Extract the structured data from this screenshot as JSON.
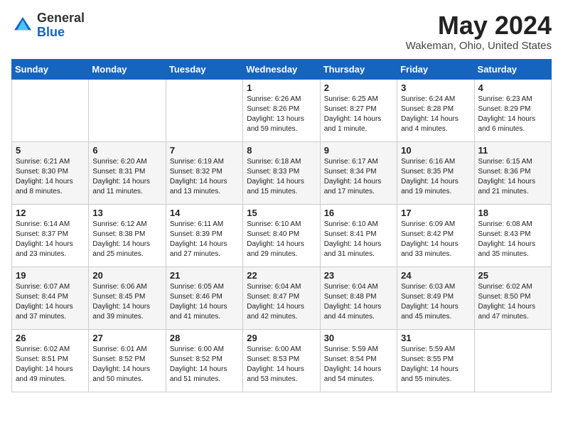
{
  "logo": {
    "general": "General",
    "blue": "Blue"
  },
  "title": {
    "month": "May 2024",
    "location": "Wakeman, Ohio, United States"
  },
  "weekdays": [
    "Sunday",
    "Monday",
    "Tuesday",
    "Wednesday",
    "Thursday",
    "Friday",
    "Saturday"
  ],
  "weeks": [
    [
      {
        "day": "",
        "sunrise": "",
        "sunset": "",
        "daylight": ""
      },
      {
        "day": "",
        "sunrise": "",
        "sunset": "",
        "daylight": ""
      },
      {
        "day": "",
        "sunrise": "",
        "sunset": "",
        "daylight": ""
      },
      {
        "day": "1",
        "sunrise": "Sunrise: 6:26 AM",
        "sunset": "Sunset: 8:26 PM",
        "daylight": "Daylight: 13 hours and 59 minutes."
      },
      {
        "day": "2",
        "sunrise": "Sunrise: 6:25 AM",
        "sunset": "Sunset: 8:27 PM",
        "daylight": "Daylight: 14 hours and 1 minute."
      },
      {
        "day": "3",
        "sunrise": "Sunrise: 6:24 AM",
        "sunset": "Sunset: 8:28 PM",
        "daylight": "Daylight: 14 hours and 4 minutes."
      },
      {
        "day": "4",
        "sunrise": "Sunrise: 6:23 AM",
        "sunset": "Sunset: 8:29 PM",
        "daylight": "Daylight: 14 hours and 6 minutes."
      }
    ],
    [
      {
        "day": "5",
        "sunrise": "Sunrise: 6:21 AM",
        "sunset": "Sunset: 8:30 PM",
        "daylight": "Daylight: 14 hours and 8 minutes."
      },
      {
        "day": "6",
        "sunrise": "Sunrise: 6:20 AM",
        "sunset": "Sunset: 8:31 PM",
        "daylight": "Daylight: 14 hours and 11 minutes."
      },
      {
        "day": "7",
        "sunrise": "Sunrise: 6:19 AM",
        "sunset": "Sunset: 8:32 PM",
        "daylight": "Daylight: 14 hours and 13 minutes."
      },
      {
        "day": "8",
        "sunrise": "Sunrise: 6:18 AM",
        "sunset": "Sunset: 8:33 PM",
        "daylight": "Daylight: 14 hours and 15 minutes."
      },
      {
        "day": "9",
        "sunrise": "Sunrise: 6:17 AM",
        "sunset": "Sunset: 8:34 PM",
        "daylight": "Daylight: 14 hours and 17 minutes."
      },
      {
        "day": "10",
        "sunrise": "Sunrise: 6:16 AM",
        "sunset": "Sunset: 8:35 PM",
        "daylight": "Daylight: 14 hours and 19 minutes."
      },
      {
        "day": "11",
        "sunrise": "Sunrise: 6:15 AM",
        "sunset": "Sunset: 8:36 PM",
        "daylight": "Daylight: 14 hours and 21 minutes."
      }
    ],
    [
      {
        "day": "12",
        "sunrise": "Sunrise: 6:14 AM",
        "sunset": "Sunset: 8:37 PM",
        "daylight": "Daylight: 14 hours and 23 minutes."
      },
      {
        "day": "13",
        "sunrise": "Sunrise: 6:12 AM",
        "sunset": "Sunset: 8:38 PM",
        "daylight": "Daylight: 14 hours and 25 minutes."
      },
      {
        "day": "14",
        "sunrise": "Sunrise: 6:11 AM",
        "sunset": "Sunset: 8:39 PM",
        "daylight": "Daylight: 14 hours and 27 minutes."
      },
      {
        "day": "15",
        "sunrise": "Sunrise: 6:10 AM",
        "sunset": "Sunset: 8:40 PM",
        "daylight": "Daylight: 14 hours and 29 minutes."
      },
      {
        "day": "16",
        "sunrise": "Sunrise: 6:10 AM",
        "sunset": "Sunset: 8:41 PM",
        "daylight": "Daylight: 14 hours and 31 minutes."
      },
      {
        "day": "17",
        "sunrise": "Sunrise: 6:09 AM",
        "sunset": "Sunset: 8:42 PM",
        "daylight": "Daylight: 14 hours and 33 minutes."
      },
      {
        "day": "18",
        "sunrise": "Sunrise: 6:08 AM",
        "sunset": "Sunset: 8:43 PM",
        "daylight": "Daylight: 14 hours and 35 minutes."
      }
    ],
    [
      {
        "day": "19",
        "sunrise": "Sunrise: 6:07 AM",
        "sunset": "Sunset: 8:44 PM",
        "daylight": "Daylight: 14 hours and 37 minutes."
      },
      {
        "day": "20",
        "sunrise": "Sunrise: 6:06 AM",
        "sunset": "Sunset: 8:45 PM",
        "daylight": "Daylight: 14 hours and 39 minutes."
      },
      {
        "day": "21",
        "sunrise": "Sunrise: 6:05 AM",
        "sunset": "Sunset: 8:46 PM",
        "daylight": "Daylight: 14 hours and 41 minutes."
      },
      {
        "day": "22",
        "sunrise": "Sunrise: 6:04 AM",
        "sunset": "Sunset: 8:47 PM",
        "daylight": "Daylight: 14 hours and 42 minutes."
      },
      {
        "day": "23",
        "sunrise": "Sunrise: 6:04 AM",
        "sunset": "Sunset: 8:48 PM",
        "daylight": "Daylight: 14 hours and 44 minutes."
      },
      {
        "day": "24",
        "sunrise": "Sunrise: 6:03 AM",
        "sunset": "Sunset: 8:49 PM",
        "daylight": "Daylight: 14 hours and 45 minutes."
      },
      {
        "day": "25",
        "sunrise": "Sunrise: 6:02 AM",
        "sunset": "Sunset: 8:50 PM",
        "daylight": "Daylight: 14 hours and 47 minutes."
      }
    ],
    [
      {
        "day": "26",
        "sunrise": "Sunrise: 6:02 AM",
        "sunset": "Sunset: 8:51 PM",
        "daylight": "Daylight: 14 hours and 49 minutes."
      },
      {
        "day": "27",
        "sunrise": "Sunrise: 6:01 AM",
        "sunset": "Sunset: 8:52 PM",
        "daylight": "Daylight: 14 hours and 50 minutes."
      },
      {
        "day": "28",
        "sunrise": "Sunrise: 6:00 AM",
        "sunset": "Sunset: 8:52 PM",
        "daylight": "Daylight: 14 hours and 51 minutes."
      },
      {
        "day": "29",
        "sunrise": "Sunrise: 6:00 AM",
        "sunset": "Sunset: 8:53 PM",
        "daylight": "Daylight: 14 hours and 53 minutes."
      },
      {
        "day": "30",
        "sunrise": "Sunrise: 5:59 AM",
        "sunset": "Sunset: 8:54 PM",
        "daylight": "Daylight: 14 hours and 54 minutes."
      },
      {
        "day": "31",
        "sunrise": "Sunrise: 5:59 AM",
        "sunset": "Sunset: 8:55 PM",
        "daylight": "Daylight: 14 hours and 55 minutes."
      },
      {
        "day": "",
        "sunrise": "",
        "sunset": "",
        "daylight": ""
      }
    ]
  ]
}
